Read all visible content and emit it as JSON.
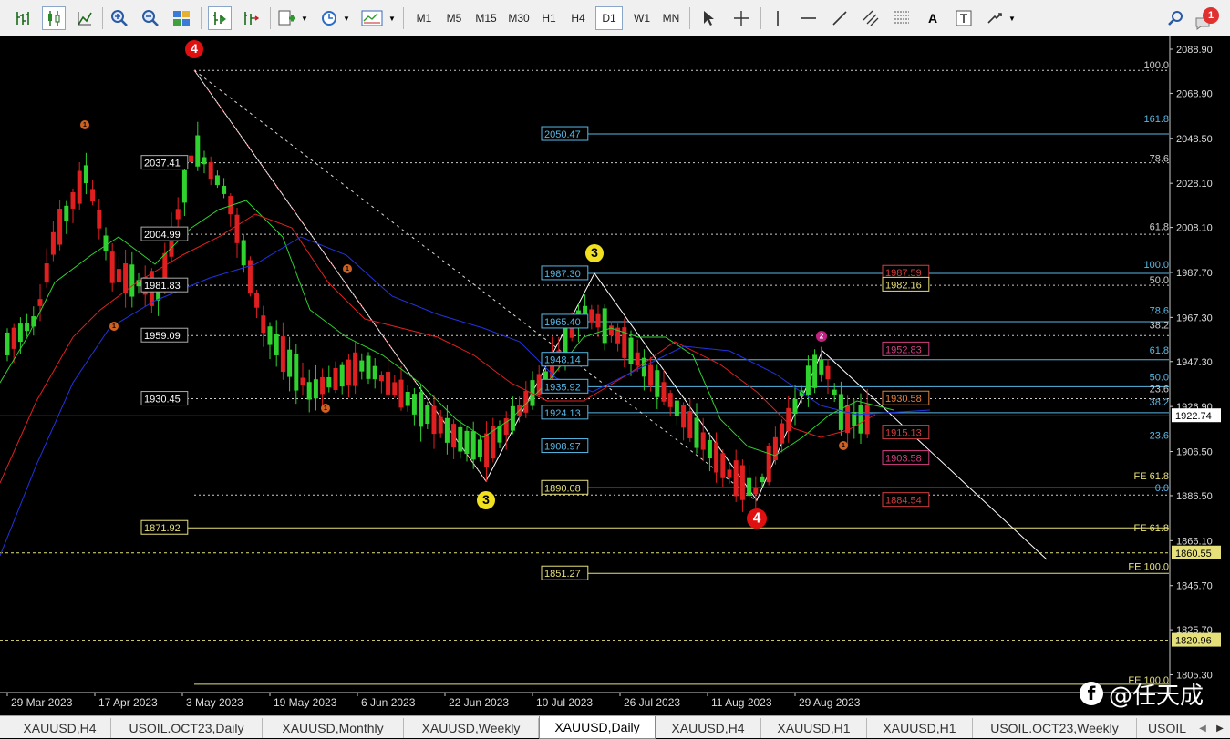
{
  "toolbar": {
    "timeframes": [
      "M1",
      "M5",
      "M15",
      "M30",
      "H1",
      "H4",
      "D1",
      "W1",
      "MN"
    ],
    "active_timeframe": "D1",
    "notification_count": "1",
    "text_tool": "A",
    "icons": [
      "bar-chart-icon",
      "candlestick-icon",
      "line-chart-icon",
      "zoom-in-icon",
      "zoom-out-icon",
      "tile-windows-icon",
      "autoscroll-icon",
      "chart-shift-icon",
      "new-order-icon",
      "periods-icon",
      "templates-icon",
      "cursor-icon",
      "crosshair-icon",
      "vertical-line-icon",
      "horizontal-line-icon",
      "trendline-icon",
      "channel-icon",
      "fibonacci-icon",
      "text-label-icon",
      "arrows-icon",
      "search-icon"
    ]
  },
  "chart": {
    "symbol": "XAUUSD",
    "timeframe": "Daily",
    "current_price": "1922.74",
    "price_axis_labels": [
      "2088.90",
      "2068.90",
      "2048.50",
      "2028.10",
      "2008.10",
      "1987.70",
      "1967.30",
      "1947.30",
      "1926.90",
      "1906.50",
      "1886.50",
      "1866.10",
      "1845.70",
      "1825.70",
      "1805.30"
    ],
    "date_axis_labels": [
      "29 Mar 2023",
      "17 Apr 2023",
      "3 May 2023",
      "19 May 2023",
      "6 Jun 2023",
      "22 Jun 2023",
      "10 Jul 2023",
      "26 Jul 2023",
      "11 Aug 2023",
      "29 Aug 2023"
    ],
    "highlighted_levels": [
      "1860.55",
      "1820.96"
    ],
    "level_boxes_left": [
      "2037.41",
      "2004.99",
      "1981.83",
      "1959.09",
      "1930.45",
      "1871.92"
    ],
    "level_boxes_mid": [
      "2050.47",
      "1987.30",
      "1965.40",
      "1948.14",
      "1935.92",
      "1924.13",
      "1908.97",
      "1890.08",
      "1851.27"
    ],
    "level_boxes_right": [
      "1987.59",
      "1982.16",
      "1952.83",
      "1930.58",
      "1915.13",
      "1903.58",
      "1884.54"
    ],
    "fib_labels_right": [
      "100.0",
      "161.8",
      "78.6",
      "61.8",
      "100.0",
      "50.0",
      "78.6",
      "38.2",
      "61.8",
      "50.0",
      "23.6",
      "38.2",
      "23.6",
      "FE 61.8",
      "0.0",
      "FE 61.8",
      "FE 100.0",
      "FE 100.0"
    ],
    "wave_labels": [
      "4",
      "1",
      "1",
      "1",
      "1",
      "3",
      "3",
      "2",
      "4",
      "1"
    ],
    "watermark": "@任天成"
  },
  "colors": {
    "background": "#000000",
    "bull_candle": "#2fd22f",
    "bear_candle": "#e02020",
    "fib_line": "#57b8e6",
    "fe_line": "#e6e07a",
    "ma_fast": "#2fd22f",
    "ma_mid": "#e02020",
    "ma_slow": "#2233dd"
  },
  "tabs": [
    "XAUUSD,H4",
    "USOIL.OCT23,Daily",
    "XAUUSD,Monthly",
    "XAUUSD,Weekly",
    "XAUUSD,Daily",
    "XAUUSD,H4",
    "XAUUSD,H1",
    "XAUUSD,H1",
    "USOIL.OCT23,Weekly",
    "USOIL"
  ],
  "active_tab_index": 4
}
